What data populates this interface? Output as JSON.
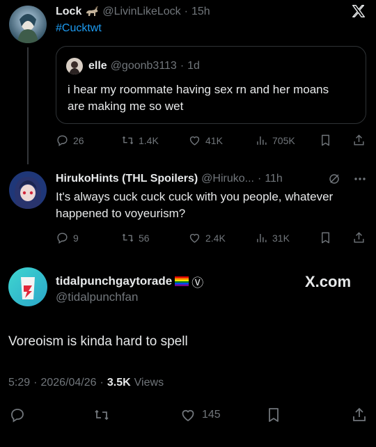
{
  "tweet1": {
    "name": "Lock",
    "handle": "@LivinLikeLock",
    "dot": "·",
    "time": "15h",
    "hashtag": "#Cucktwt",
    "x_logo": "𝕏",
    "quote": {
      "name": "elle",
      "handle": "@goonb3113",
      "dot": "·",
      "time": "1d",
      "text": "i hear my roommate having sex rn and her moans are making me so wet"
    },
    "replies": "26",
    "reposts": "1.4K",
    "likes": "41K",
    "views": "705K"
  },
  "tweet2": {
    "name": "HirukoHints (THL Spoilers)",
    "handle": "@Hiruko...",
    "dot": "·",
    "time": "11h",
    "text": "It's always cuck cuck cuck with you people, whatever happened to voyeurism?",
    "replies": "9",
    "reposts": "56",
    "likes": "2.4K",
    "views": "31K"
  },
  "tweet3": {
    "name": "tidalpunchgaytorade",
    "verified_mark": "Ⓥ",
    "handle": "@tidalpunchfan",
    "brand": "X.com",
    "text": "Voreoism is kinda hard to spell",
    "time": "5:29",
    "dot1": "·",
    "date": "2026/04/26",
    "dot2": "·",
    "views_count": "3.5K",
    "views_label": "Views",
    "likes": "145"
  },
  "colors": {
    "link": "#1d9bf0",
    "muted": "#71767b",
    "border": "#2f3336",
    "text": "#e7e9ea"
  },
  "icons": [
    "reply-icon",
    "repost-icon",
    "like-icon",
    "views-icon",
    "bookmark-icon",
    "share-icon",
    "more-icon",
    "grok-icon",
    "x-logo-icon"
  ]
}
